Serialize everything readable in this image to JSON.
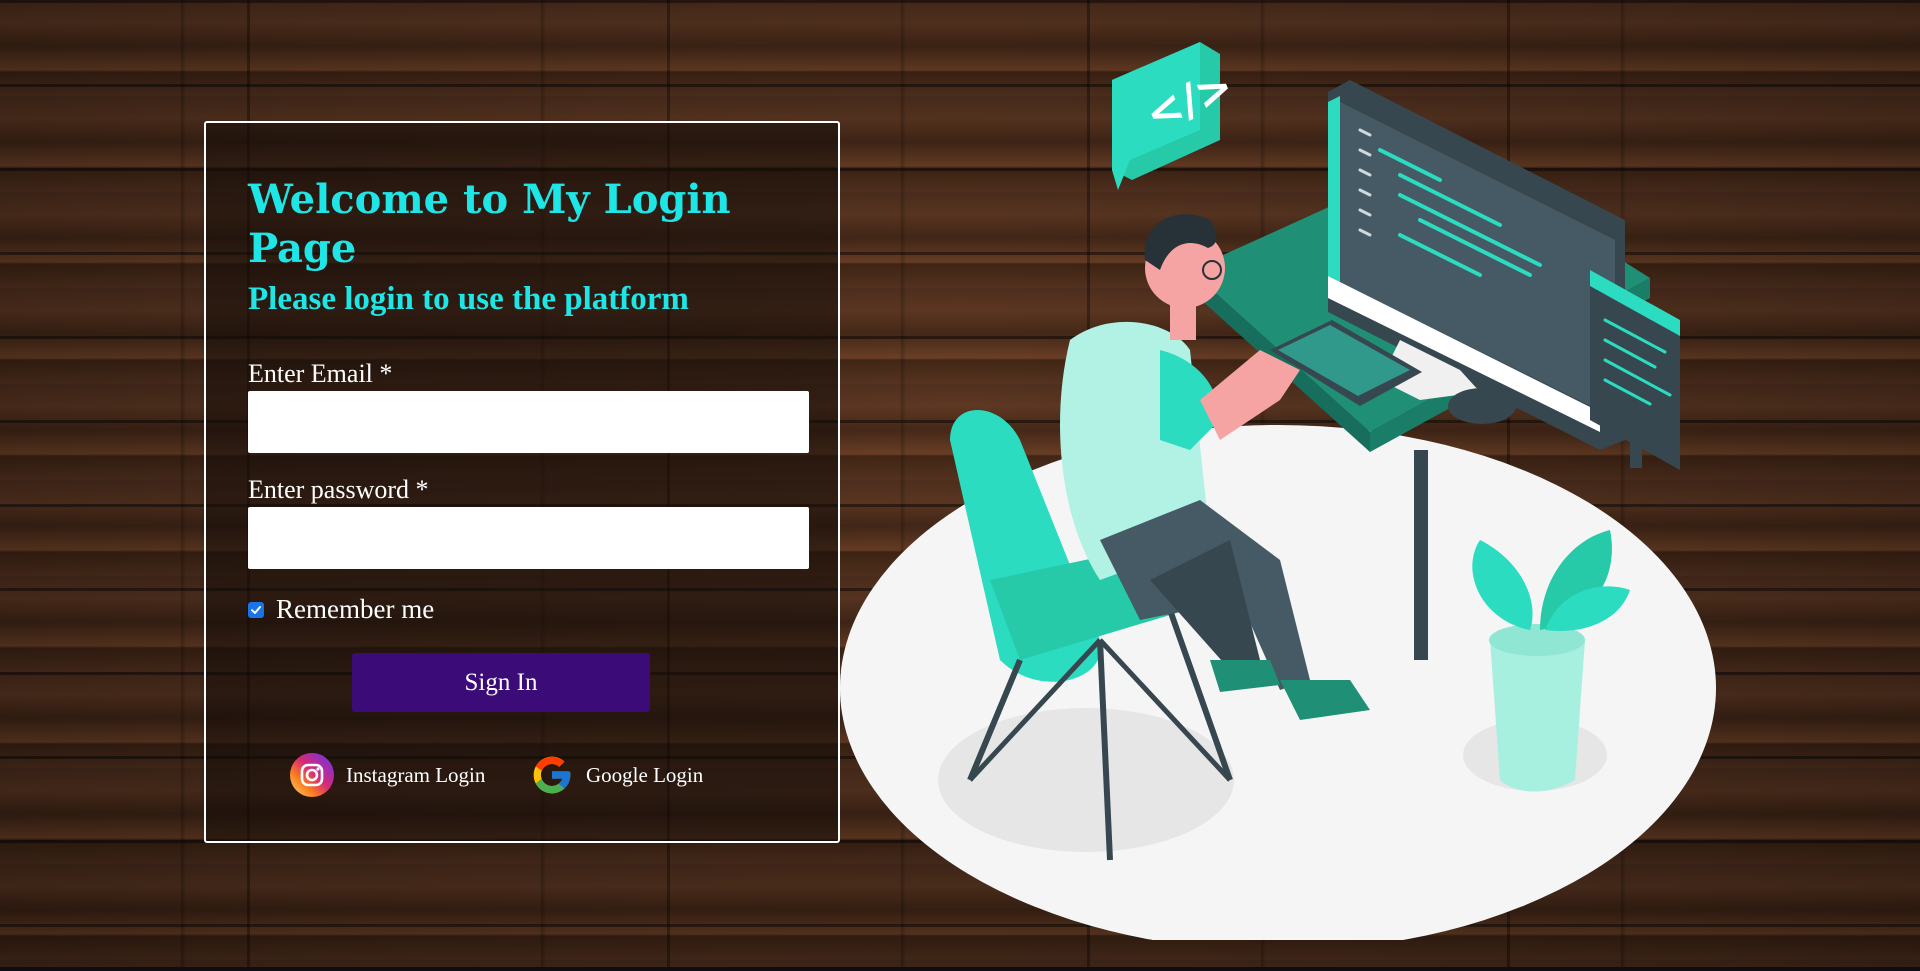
{
  "login": {
    "title": "Welcome to My Login Page",
    "subtitle": "Please login to use the platform",
    "email_label": "Enter Email *",
    "email_value": "",
    "password_label": "Enter password *",
    "password_value": "",
    "remember_label": "Remember me",
    "remember_checked": true,
    "signin_label": "Sign In"
  },
  "social": {
    "instagram_label": "Instagram Login",
    "google_label": "Google Login"
  },
  "illustration": {
    "code_bubble_text": "</>"
  },
  "colors": {
    "accent_cyan": "#1fe6e6",
    "button_purple": "#3b0c78",
    "illustration_green": "#2bdcc0"
  }
}
